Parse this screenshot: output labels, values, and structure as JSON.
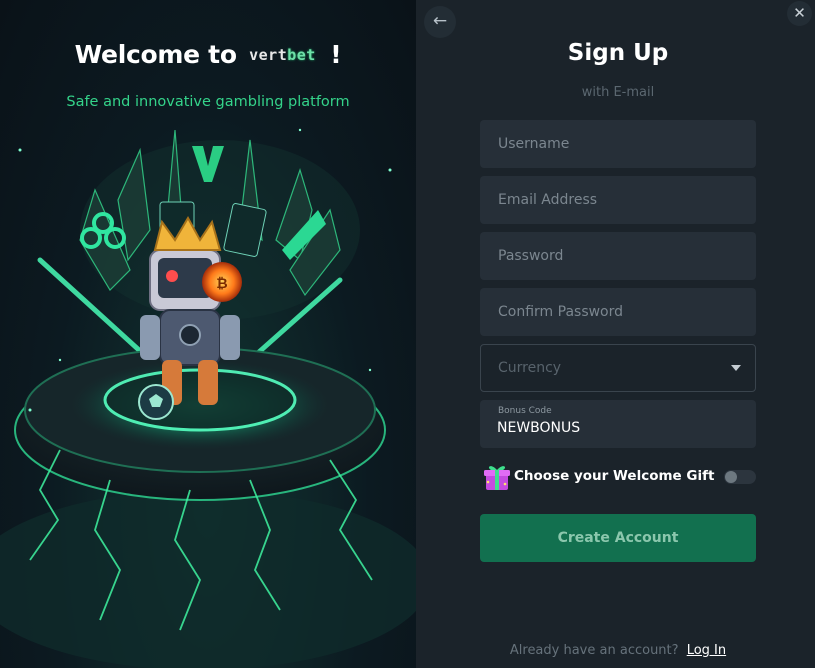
{
  "left": {
    "welcome_prefix": "Welcome to",
    "logo_part1": "vert",
    "logo_part2": "bet",
    "welcome_suffix": "!",
    "subtitle": "Safe and innovative gambling platform"
  },
  "icons": {
    "back": "arrow-left-icon",
    "close": "close-icon",
    "dropdown": "chevron-down-icon",
    "gift": "gift-box-icon"
  },
  "form": {
    "title": "Sign Up",
    "subtitle": "with E-mail",
    "username_placeholder": "Username",
    "email_placeholder": "Email Address",
    "password_placeholder": "Password",
    "confirm_password_placeholder": "Confirm Password",
    "currency_placeholder": "Currency",
    "bonus_label": "Bonus Code",
    "bonus_value": "NEWBONUS",
    "gift_label": "Choose your Welcome Gift",
    "gift_toggle_on": false,
    "submit_label": "Create Account",
    "login_prompt": "Already have an account?",
    "login_link": "Log In"
  },
  "colors": {
    "accent": "#34d38a",
    "button": "#12704f",
    "panel": "#1b232a",
    "field": "#262f38"
  }
}
